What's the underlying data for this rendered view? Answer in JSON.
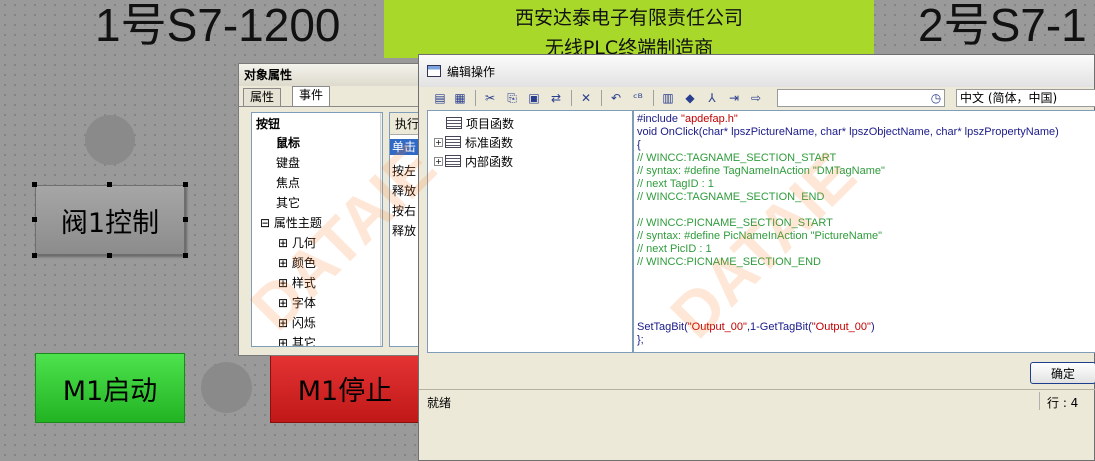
{
  "hmi": {
    "title_left": "1号S7-1200",
    "title_right": "2号S7-1",
    "banner": {
      "line1": "西安达泰电子有限责任公司",
      "line2": "无线PLC终端制造商"
    },
    "valve_button": "阀1控制",
    "start_button": "M1启动",
    "stop_button": "M1停止",
    "watermark": "DATAIE"
  },
  "properties_dialog": {
    "title": "对象属性",
    "tabs": [
      "属性",
      "事件"
    ],
    "active_tab": "事件",
    "tree": [
      {
        "label": "按钮",
        "bold": true
      },
      {
        "label": "鼠标",
        "bold": true
      },
      {
        "label": "键盘"
      },
      {
        "label": "焦点"
      },
      {
        "label": "其它"
      },
      {
        "label": "属性主题"
      },
      {
        "label": "几何"
      },
      {
        "label": "颜色"
      },
      {
        "label": "样式"
      },
      {
        "label": "字体"
      },
      {
        "label": "闪烁"
      },
      {
        "label": "其它"
      }
    ],
    "action_header": "执行",
    "actions": [
      "单击",
      "按左",
      "释放",
      "按右",
      "释放"
    ]
  },
  "editor": {
    "title": "编辑操作",
    "language": "中文 (简体，中国)",
    "function_tree": [
      "项目函数",
      "标准函数",
      "内部函数"
    ],
    "code_lines": [
      {
        "t": "#include \"apdefap.h\"",
        "k": "include"
      },
      {
        "t": "void OnClick(char* lpszPictureName, char* lpszObjectName, char* lpszPropertyName)",
        "k": "kw"
      },
      {
        "t": "{",
        "k": "kw"
      },
      {
        "t": "// WINCC:TAGNAME_SECTION_START",
        "k": "comment"
      },
      {
        "t": "// syntax: #define TagNameInAction \"DMTagName\"",
        "k": "comment"
      },
      {
        "t": "// next TagID : 1",
        "k": "comment"
      },
      {
        "t": "// WINCC:TAGNAME_SECTION_END",
        "k": "comment"
      },
      {
        "t": "",
        "k": "kw"
      },
      {
        "t": "// WINCC:PICNAME_SECTION_START",
        "k": "comment"
      },
      {
        "t": "// syntax: #define PicNameInAction \"PictureName\"",
        "k": "comment"
      },
      {
        "t": "// next PicID : 1",
        "k": "comment"
      },
      {
        "t": "// WINCC:PICNAME_SECTION_END",
        "k": "comment"
      },
      {
        "t": "",
        "k": "kw"
      },
      {
        "t": "",
        "k": "kw"
      },
      {
        "t": "",
        "k": "kw"
      },
      {
        "t": "",
        "k": "kw"
      },
      {
        "t": "SetTagBit(\"Output_00\",1-GetTagBit(\"Output_00\")",
        "k": "call"
      },
      {
        "t": "};",
        "k": "kw"
      }
    ],
    "ok_button": "确定",
    "status_left": "就绪",
    "status_right": "行 : 4"
  },
  "colors": {
    "banner": "#a8d82a",
    "start_button": "#2fc82f",
    "stop_button": "#d42121",
    "comment": "#2f9c3c",
    "string": "#c00000"
  }
}
